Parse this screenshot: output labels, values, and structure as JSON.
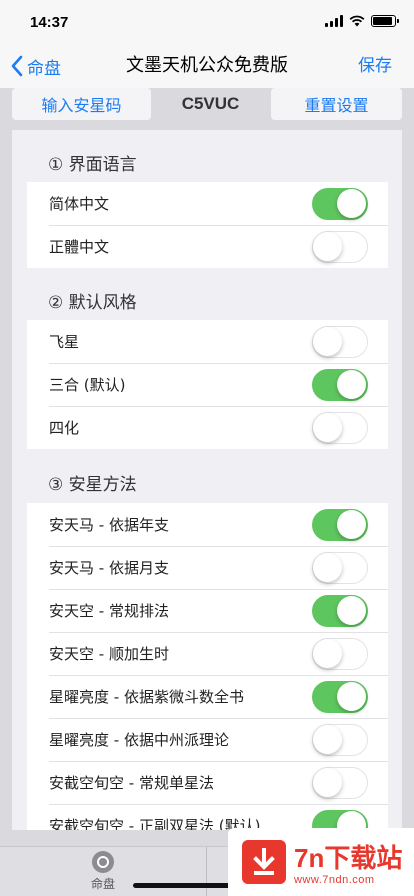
{
  "status_bar": {
    "time": "14:37"
  },
  "nav": {
    "back_label": "命盘",
    "title": "文墨天机公众免费版",
    "save_label": "保存"
  },
  "top_row": {
    "input_code_label": "输入安星码",
    "code": "C5VUC",
    "reset_label": "重置设置"
  },
  "sections": [
    {
      "header": "① 界面语言",
      "rows": [
        {
          "label": "简体中文",
          "on": true
        },
        {
          "label": "正體中文",
          "on": false
        }
      ]
    },
    {
      "header": "② 默认风格",
      "rows": [
        {
          "label": "飞星",
          "on": false
        },
        {
          "label": "三合 (默认)",
          "on": true
        },
        {
          "label": "四化",
          "on": false
        }
      ]
    },
    {
      "header": "③ 安星方法",
      "rows": [
        {
          "label": "安天马 - 依据年支",
          "on": true
        },
        {
          "label": "安天马 - 依据月支",
          "on": false
        },
        {
          "label": "安天空 - 常规排法",
          "on": true
        },
        {
          "label": "安天空 - 顺加生时",
          "on": false
        },
        {
          "label": "星曜亮度 - 依据紫微斗数全书",
          "on": true
        },
        {
          "label": "星曜亮度 - 依据中州派理论",
          "on": false
        },
        {
          "label": "安截空旬空 - 常规单星法",
          "on": false
        },
        {
          "label": "安截空旬空 - 正副双星法 (默认)",
          "on": true
        }
      ]
    }
  ],
  "tab_bar": {
    "tab_label": "命盘",
    "tab_icon": "chart-disc-icon"
  },
  "watermark": {
    "title": "7n下载站",
    "url": "www.7ndn.com"
  },
  "colors": {
    "accent": "#1a7cf4",
    "toggle_on": "#5ec65f",
    "watermark": "#e8372c"
  }
}
